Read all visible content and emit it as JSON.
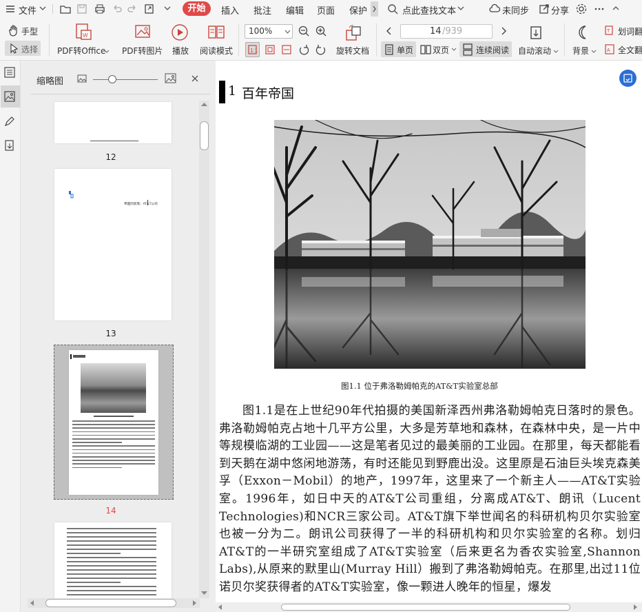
{
  "menubar": {
    "file_label": "文件",
    "tabs": [
      "开始",
      "插入",
      "批注",
      "编辑",
      "页面",
      "保护"
    ],
    "search_label": "点此查找文本",
    "sync_label": "未同步",
    "share_label": "分享"
  },
  "ribbon": {
    "hand_label": "手型",
    "select_label": "选择",
    "pdf_office_label": "PDF转Office",
    "pdf_image_label": "PDF转图片",
    "play_label": "播放",
    "read_mode_label": "阅读模式",
    "zoom_value": "100%",
    "rotate_label": "旋转文档",
    "page_current": "14",
    "page_total": "/939",
    "single_page_label": "单页",
    "double_page_label": "双页",
    "continuous_label": "连续阅读",
    "autoscroll_label": "自动滚动",
    "background_label": "背景",
    "translate_word_label": "划词翻",
    "fulltext_label": "全文翻"
  },
  "thumbnail_panel": {
    "title": "缩略图",
    "zoom_level": 0.3,
    "pages": [
      "12",
      "13",
      "14"
    ],
    "current_page": "14",
    "page13_header": "帝国的衰落：AT&T公司"
  },
  "document": {
    "chapter_number": "1",
    "chapter_title": "百年帝国",
    "figure_caption": "图1.1  位于弗洛勒姆帕克的AT&T实验室总部",
    "body": "图1.1是在上世纪90年代拍摄的美国新泽西州弗洛勒姆帕克日落时的景色。弗洛勒姆帕克占地十几平方公里，大多是芳草地和森林，在森林中央，是一片中等规模临湖的工业园——这是笔者见过的最美丽的工业园。在那里，每天都能看到天鹅在湖中悠闲地游荡，有时还能见到野鹿出没。这里原是石油巨头埃克森美孚（Exxon－Mobil）的地产，1997年，这里来了一个新主人——AT&T实验室。1996年，如日中天的AT&T公司重组，分离成AT&T、朗讯（Lucent Technologies)和NCR三家公司。AT&T旗下举世闻名的科研机构贝尔实验室也被一分为二。朗讯公司获得了一半的科研机构和贝尔实验室的名称。划归AT&T的一半研究室组成了AT&T实验室（后来更名为香农实验室,Shannon Labs),从原来的默里山(Murray Hill）搬到了弗洛勒姆帕克。在那里,出过11位诺贝尔奖获得者的AT&T实验室，像一颗进人晚年的恒星，爆发"
  },
  "colors": {
    "accent_red": "#e0494a",
    "link_blue": "#2b6fd6"
  }
}
